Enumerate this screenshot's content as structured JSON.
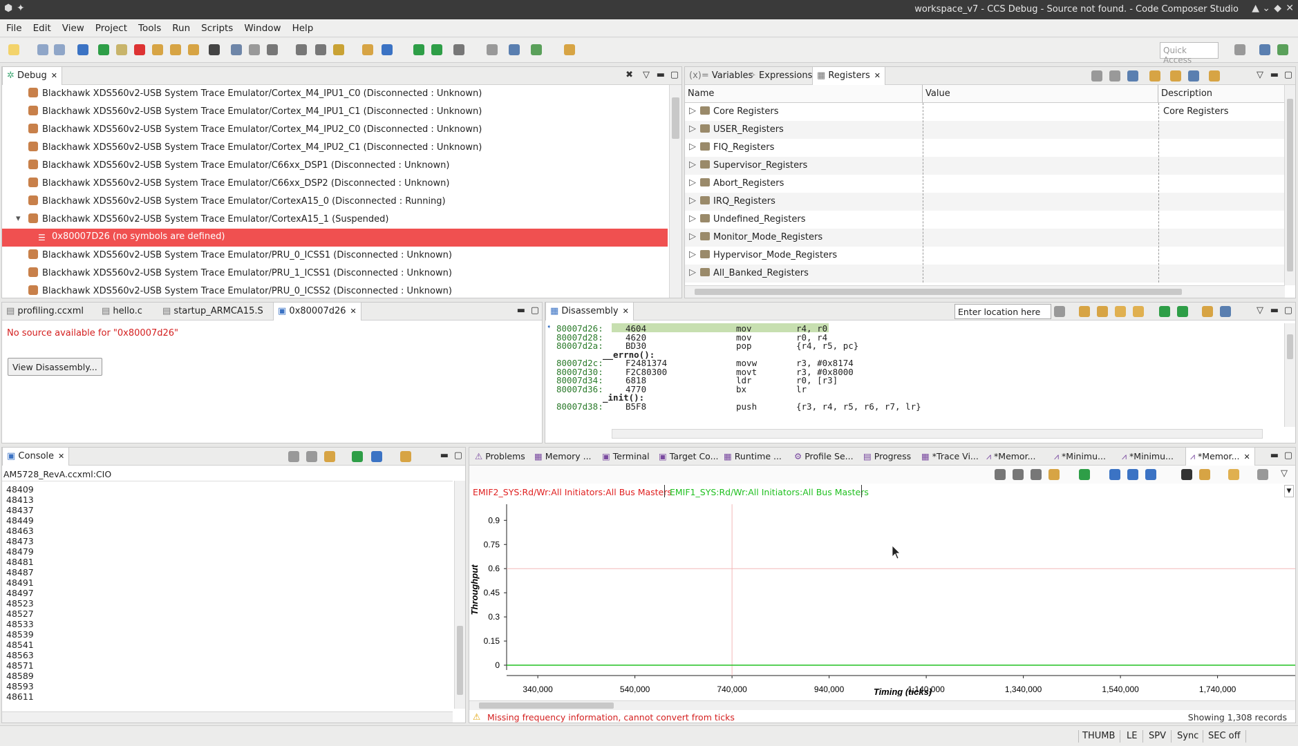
{
  "window": {
    "title": "workspace_v7 - CCS Debug - Source not found. - Code Composer Studio"
  },
  "menu": [
    "File",
    "Edit",
    "View",
    "Project",
    "Tools",
    "Run",
    "Scripts",
    "Window",
    "Help"
  ],
  "quick_access": {
    "placeholder": "Quick Access"
  },
  "debug": {
    "tab": "Debug",
    "items": [
      {
        "label": "Blackhawk XDS560v2-USB System Trace Emulator/Cortex_M4_IPU1_C0 (Disconnected : Unknown)",
        "selected": false
      },
      {
        "label": "Blackhawk XDS560v2-USB System Trace Emulator/Cortex_M4_IPU1_C1 (Disconnected : Unknown)",
        "selected": false
      },
      {
        "label": "Blackhawk XDS560v2-USB System Trace Emulator/Cortex_M4_IPU2_C0 (Disconnected : Unknown)",
        "selected": false
      },
      {
        "label": "Blackhawk XDS560v2-USB System Trace Emulator/Cortex_M4_IPU2_C1 (Disconnected : Unknown)",
        "selected": false
      },
      {
        "label": "Blackhawk XDS560v2-USB System Trace Emulator/C66xx_DSP1 (Disconnected : Unknown)",
        "selected": false
      },
      {
        "label": "Blackhawk XDS560v2-USB System Trace Emulator/C66xx_DSP2 (Disconnected : Unknown)",
        "selected": false
      },
      {
        "label": "Blackhawk XDS560v2-USB System Trace Emulator/CortexA15_0 (Disconnected : Running)",
        "selected": false
      },
      {
        "label": "Blackhawk XDS560v2-USB System Trace Emulator/CortexA15_1 (Suspended)",
        "selected": false,
        "expanded": true
      },
      {
        "label": "0x80007D26  (no symbols are defined)",
        "selected": true,
        "child": true
      },
      {
        "label": "Blackhawk XDS560v2-USB System Trace Emulator/PRU_0_ICSS1 (Disconnected : Unknown)",
        "selected": false
      },
      {
        "label": "Blackhawk XDS560v2-USB System Trace Emulator/PRU_1_ICSS1 (Disconnected : Unknown)",
        "selected": false
      },
      {
        "label": "Blackhawk XDS560v2-USB System Trace Emulator/PRU_0_ICSS2 (Disconnected : Unknown)",
        "selected": false
      }
    ]
  },
  "registers": {
    "tabs": [
      "Variables",
      "Expressions",
      "Registers"
    ],
    "columns": [
      "Name",
      "Value",
      "Description"
    ],
    "rows": [
      {
        "name": "Core Registers",
        "value": "",
        "desc": "Core Registers"
      },
      {
        "name": "USER_Registers",
        "value": "",
        "desc": ""
      },
      {
        "name": "FIQ_Registers",
        "value": "",
        "desc": ""
      },
      {
        "name": "Supervisor_Registers",
        "value": "",
        "desc": ""
      },
      {
        "name": "Abort_Registers",
        "value": "",
        "desc": ""
      },
      {
        "name": "IRQ_Registers",
        "value": "",
        "desc": ""
      },
      {
        "name": "Undefined_Registers",
        "value": "",
        "desc": ""
      },
      {
        "name": "Monitor_Mode_Registers",
        "value": "",
        "desc": ""
      },
      {
        "name": "Hypervisor_Mode_Registers",
        "value": "",
        "desc": ""
      },
      {
        "name": "All_Banked_Registers",
        "value": "",
        "desc": ""
      }
    ]
  },
  "editor": {
    "tabs": [
      "profiling.ccxml",
      "hello.c",
      "startup_ARMCA15.S",
      "0x80007d26"
    ],
    "message": "No source available for \"0x80007d26\"",
    "button": "View Disassembly..."
  },
  "disassembly": {
    "tab": "Disassembly",
    "location_placeholder": "Enter location here",
    "lines": [
      {
        "addr": "80007d26:",
        "op": "4604",
        "mn": "mov",
        "args": "r4, r0",
        "current": true
      },
      {
        "addr": "80007d28:",
        "op": "4620",
        "mn": "mov",
        "args": "r0, r4"
      },
      {
        "addr": "80007d2a:",
        "op": "BD30",
        "mn": "pop",
        "args": "{r4, r5, pc}"
      },
      {
        "label": "__errno():"
      },
      {
        "addr": "80007d2c:",
        "op": "F2481374",
        "mn": "movw",
        "args": "r3, #0x8174"
      },
      {
        "addr": "80007d30:",
        "op": "F2C80300",
        "mn": "movt",
        "args": "r3, #0x8000"
      },
      {
        "addr": "80007d34:",
        "op": "6818",
        "mn": "ldr",
        "args": "r0, [r3]"
      },
      {
        "addr": "80007d36:",
        "op": "4770",
        "mn": "bx",
        "args": "lr"
      },
      {
        "label": "_init():"
      },
      {
        "addr": "80007d38:",
        "op": "B5F8",
        "mn": "push",
        "args": "{r3, r4, r5, r6, r7, lr}"
      }
    ]
  },
  "console": {
    "tab": "Console",
    "header": "AM5728_RevA.ccxml:CIO",
    "lines": [
      "48409",
      "48413",
      "48437",
      "48449",
      "48463",
      "48473",
      "48479",
      "48481",
      "48487",
      "48491",
      "48497",
      "48523",
      "48527",
      "48533",
      "48539",
      "48541",
      "48563",
      "48571",
      "48589",
      "48593",
      "48611"
    ]
  },
  "bottom_tabs": [
    "Problems",
    "Memory ...",
    "Terminal",
    "Target Co...",
    "Runtime ...",
    "Profile Se...",
    "Progress",
    "*Trace Vi...",
    "*Memor...",
    "*Minimu...",
    "*Minimu...",
    "*Memor..."
  ],
  "chart_data": {
    "type": "line",
    "series": [
      {
        "name": "EMIF2_SYS:Rd/Wr:All Initiators:All Bus Masters",
        "color": "#e02020",
        "values": []
      },
      {
        "name": "EMIF1_SYS:Rd/Wr:All Initiators:All Bus Masters",
        "color": "#20c020",
        "values": [
          0,
          0
        ]
      }
    ],
    "x": [
      290000,
      1900000
    ],
    "ylabel": "Throughput",
    "xlabel": "Timing  (ticks)",
    "yticks": [
      "0.9",
      "0.75",
      "0.6",
      "0.45",
      "0.3",
      "0.15",
      "0"
    ],
    "ytick_values": [
      0.9,
      0.75,
      0.6,
      0.45,
      0.3,
      0.15,
      0
    ],
    "xticks": [
      "340,000",
      "540,000",
      "740,000",
      "940,000",
      "1,140,000",
      "1,340,000",
      "1,540,000",
      "1,740,000"
    ],
    "xtick_values": [
      340000,
      540000,
      740000,
      940000,
      1140000,
      1340000,
      1540000,
      1740000
    ],
    "cursor_x": 740000,
    "cursor_y": 0.6,
    "xlim": [
      290000,
      1900000
    ],
    "ylim": [
      -0.03,
      1.0
    ]
  },
  "chart_status": {
    "warning": "Missing frequency information, cannot convert from ticks",
    "records": "Showing 1,308 records"
  },
  "statusbar": [
    "THUMB",
    "LE",
    "SPV",
    "Sync",
    "SEC off"
  ]
}
